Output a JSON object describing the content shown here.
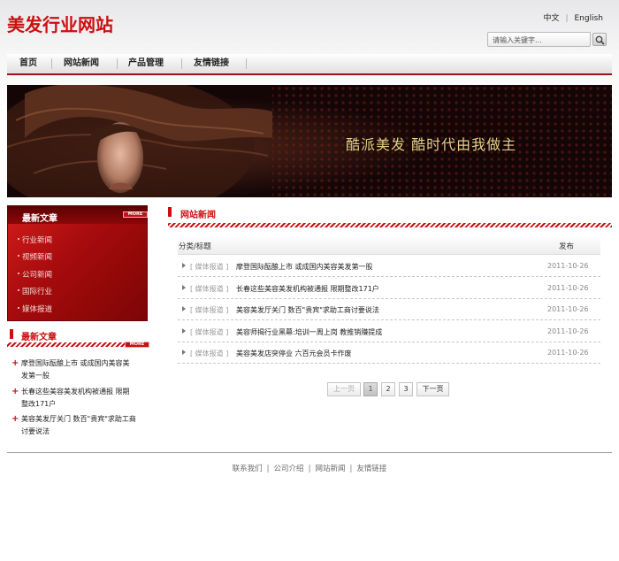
{
  "header": {
    "logo": "美发行业网站",
    "lang_zh": "中文",
    "lang_en": "English",
    "search_placeholder": "请输入关键字..."
  },
  "nav": {
    "items": [
      "首页",
      "网站新闻",
      "产品管理",
      "友情链接"
    ]
  },
  "banner": {
    "slogan": "酷派美发  酷时代由我做主"
  },
  "sidebar": {
    "box_title": "最新文章",
    "more_label": "MORE",
    "categories": [
      "行业新闻",
      "视频新闻",
      "公司新闻",
      "国际行业",
      "媒体报道"
    ],
    "recent_title": "最新文章",
    "recent_more": "MORE",
    "recent": [
      [
        "摩登国际酝酿上市 或成国内美容美",
        "发第一股"
      ],
      [
        "长春这些美容美发机构被通报 限期",
        "整改171户"
      ],
      [
        "美容美发厅关门 数百\"贵宾\"求助工商",
        "讨要说法"
      ]
    ]
  },
  "news": {
    "title": "网站新闻",
    "col_title": "分类/标题",
    "col_date": "发布",
    "rows": [
      {
        "cat": "[ 媒体报道 ]",
        "title": "摩登国际酝酿上市 或成国内美容美发第一股",
        "date": "2011-10-26"
      },
      {
        "cat": "[ 媒体报道 ]",
        "title": "长春这些美容美发机构被通报 限期整改171户",
        "date": "2011-10-26"
      },
      {
        "cat": "[ 媒体报道 ]",
        "title": "美容美发厅关门 数百\"贵宾\"求助工商讨要说法",
        "date": "2011-10-26"
      },
      {
        "cat": "[ 媒体报道 ]",
        "title": "美容师揭行业黑幕:培训一周上岗 教推销赚提成",
        "date": "2011-10-26"
      },
      {
        "cat": "[ 媒体报道 ]",
        "title": "美容美发店突停业 六百元会员卡作废",
        "date": "2011-10-26"
      }
    ]
  },
  "pagination": {
    "prev": "上一页",
    "pages": [
      "1",
      "2",
      "3"
    ],
    "next": "下一页"
  },
  "footer": {
    "links": [
      "联系我们",
      "公司介绍",
      "网站新闻",
      "友情链接"
    ]
  },
  "colors": {
    "brand_red": "#cc0e10",
    "dark_red": "#9d1416"
  }
}
